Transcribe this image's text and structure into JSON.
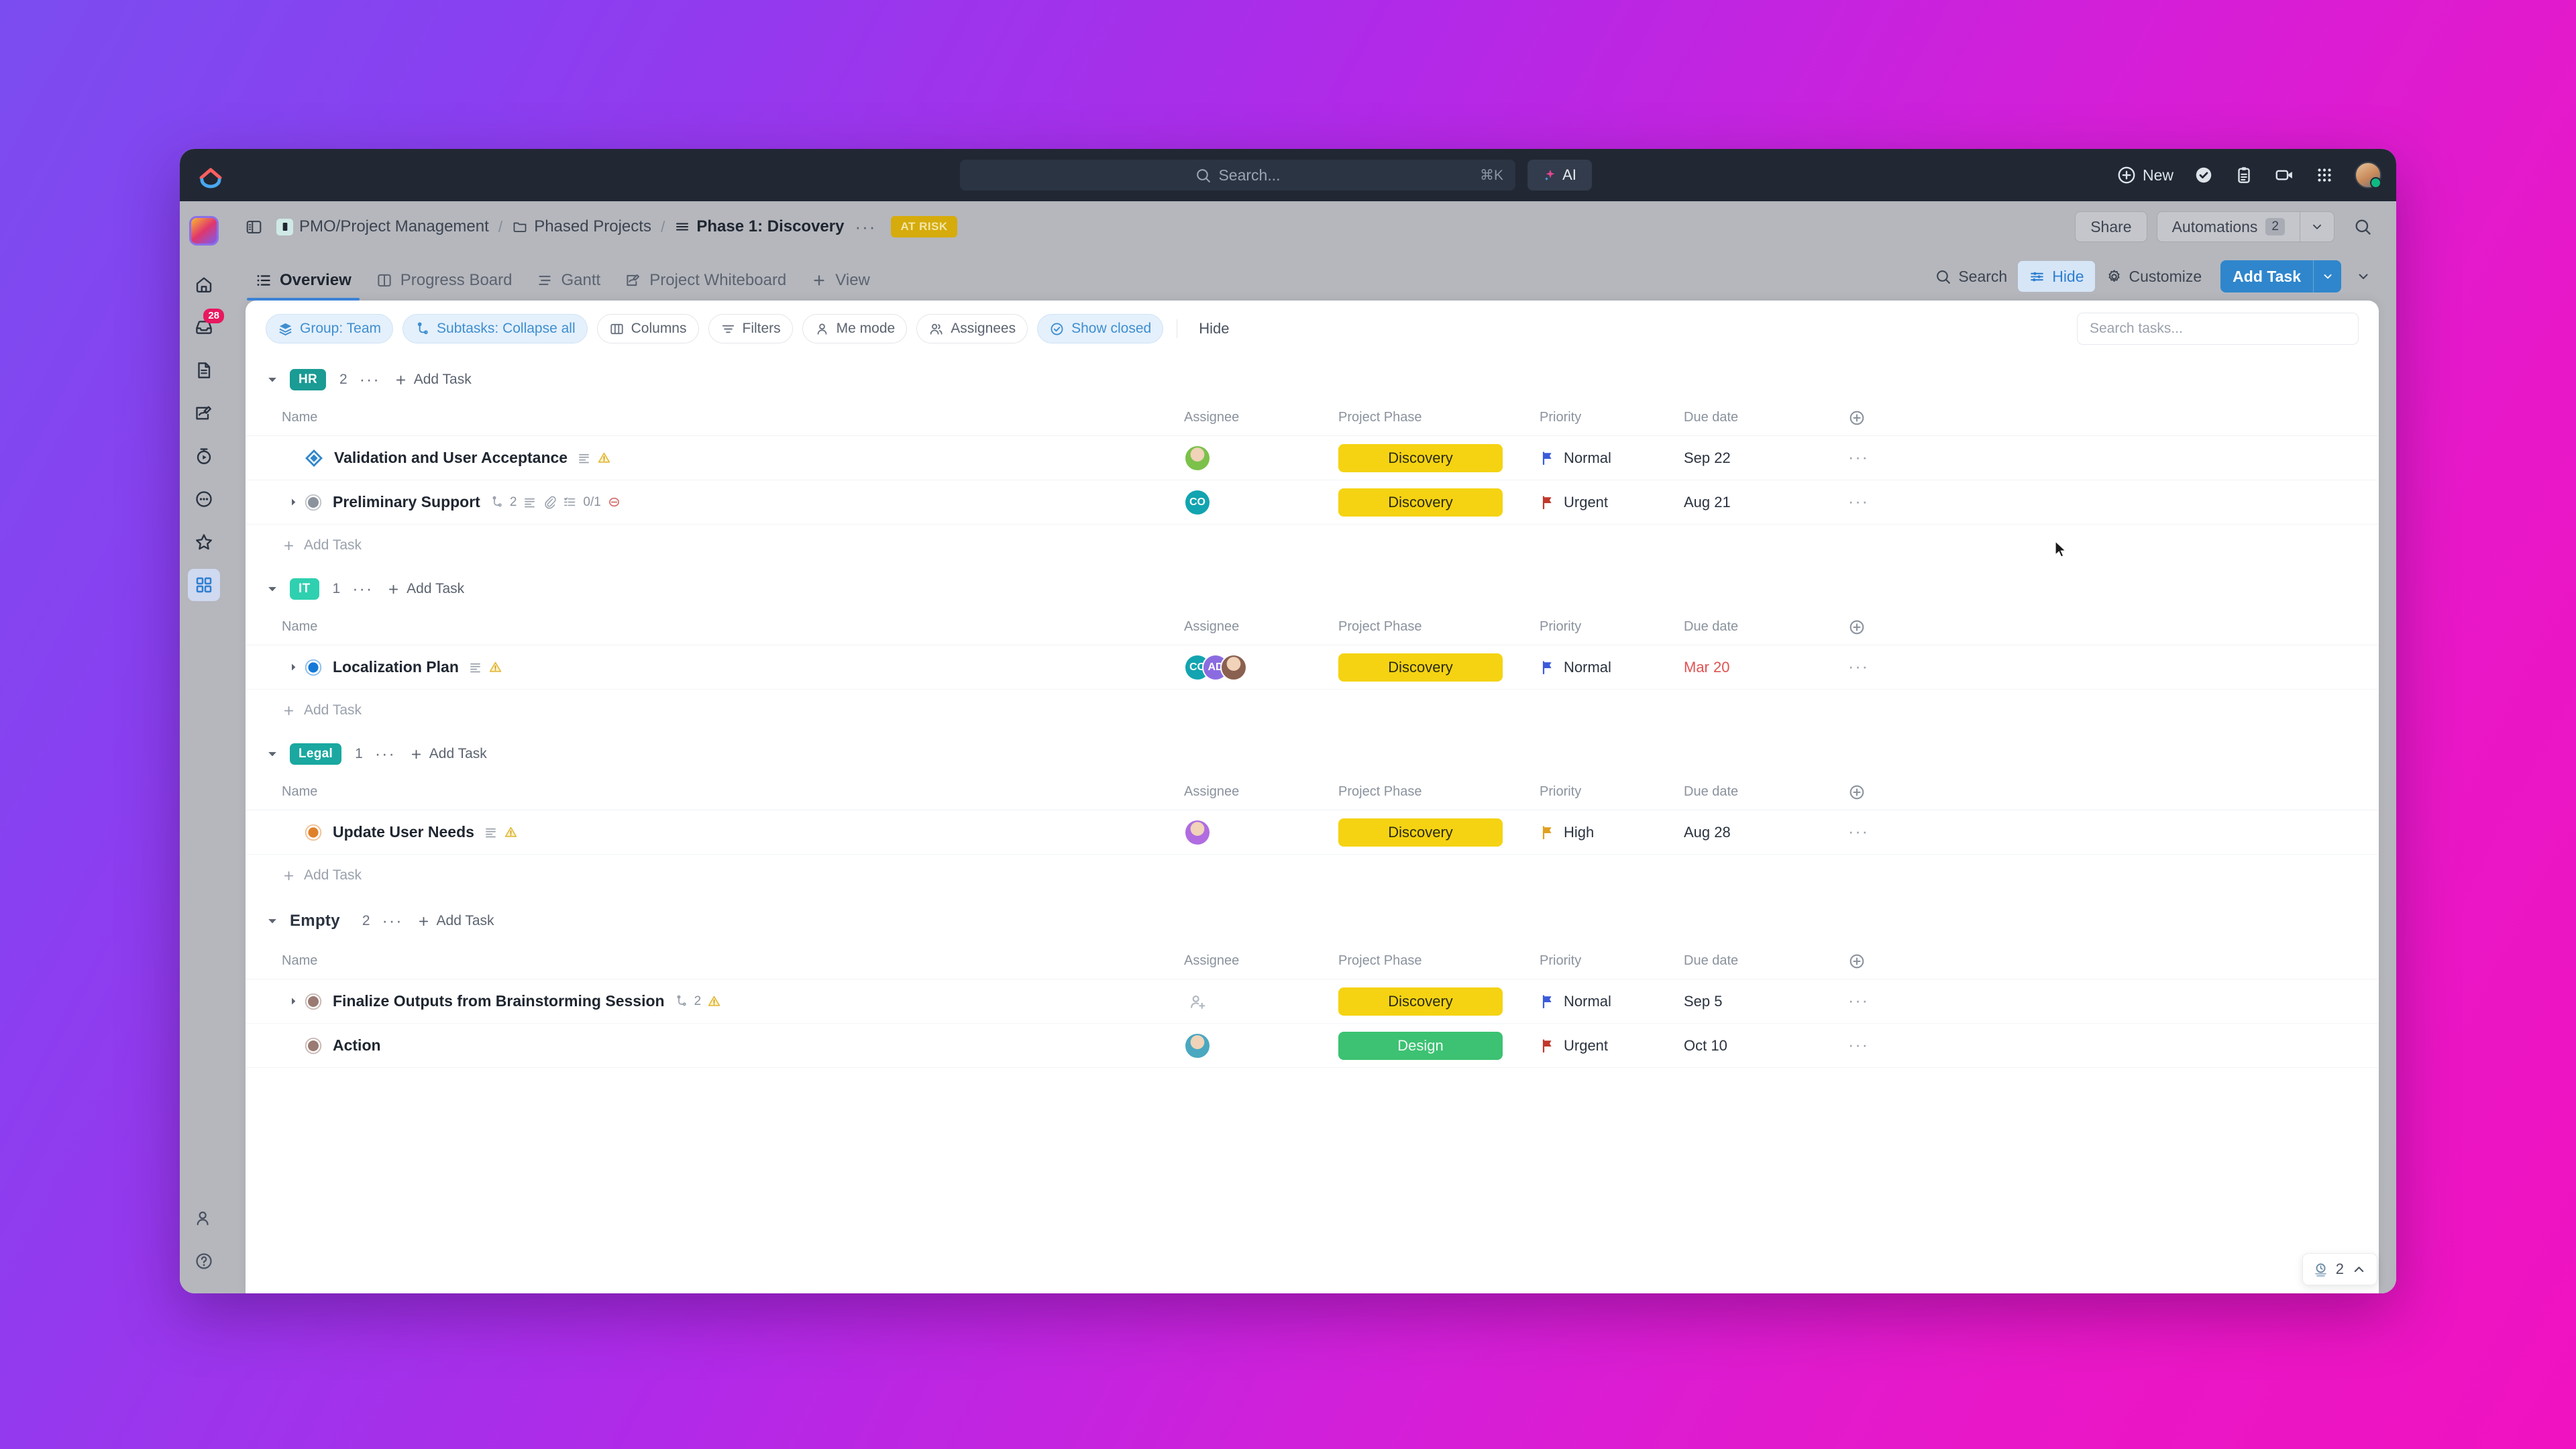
{
  "topbar": {
    "search_placeholder": "Search...",
    "search_shortcut": "⌘K",
    "ai_label": "AI",
    "new_label": "New",
    "icons": [
      "check-circle-icon",
      "clipboard-icon",
      "video-icon",
      "apps-grid-icon"
    ]
  },
  "sidebar": {
    "items": [
      {
        "name": "workspace-avatar",
        "label": ""
      },
      {
        "name": "home",
        "label": "Home"
      },
      {
        "name": "inbox",
        "label": "Inbox",
        "badge": "28"
      },
      {
        "name": "docs",
        "label": "Docs"
      },
      {
        "name": "whiteboards",
        "label": "Whiteboards"
      },
      {
        "name": "clips",
        "label": "Clips"
      },
      {
        "name": "chat",
        "label": "Chat"
      },
      {
        "name": "favorites",
        "label": "Favorites"
      },
      {
        "name": "dashboards",
        "label": "Dashboards",
        "active": true
      }
    ],
    "bottom": [
      {
        "name": "invite",
        "label": "Invite"
      },
      {
        "name": "help",
        "label": "Help"
      }
    ]
  },
  "breadcrumb": {
    "items": [
      {
        "label": "PMO/Project Management",
        "icon": "list-square-icon"
      },
      {
        "label": "Phased Projects",
        "icon": "folder-icon"
      },
      {
        "label": "Phase 1: Discovery",
        "icon": "list-icon",
        "current": true
      }
    ],
    "separator": "/",
    "overflow": "···",
    "status_badge": "AT RISK",
    "status_badge_color": "#d6ab0c"
  },
  "header_actions": {
    "share": "Share",
    "automations": "Automations",
    "automations_count": "2"
  },
  "tabs": [
    {
      "label": "Overview",
      "icon": "overview-icon",
      "active": true
    },
    {
      "label": "Progress Board",
      "icon": "board-icon",
      "active": false
    },
    {
      "label": "Gantt",
      "icon": "gantt-icon",
      "active": false
    },
    {
      "label": "Project Whiteboard",
      "icon": "whiteboard-icon",
      "active": false
    },
    {
      "label": "View",
      "icon": "plus-icon",
      "active": false
    }
  ],
  "view_actions": {
    "search": "Search",
    "hide": "Hide",
    "customize": "Customize",
    "add_task": "Add Task"
  },
  "filters": {
    "pills": [
      {
        "label": "Group: Team",
        "icon": "layers-icon",
        "active": true
      },
      {
        "label": "Subtasks: Collapse all",
        "icon": "subtask-icon",
        "active": true
      },
      {
        "label": "Columns",
        "icon": "columns-icon",
        "active": false
      },
      {
        "label": "Filters",
        "icon": "filter-icon",
        "active": false
      },
      {
        "label": "Me mode",
        "icon": "person-icon",
        "active": false
      },
      {
        "label": "Assignees",
        "icon": "people-icon",
        "active": false
      },
      {
        "label": "Show closed",
        "icon": "check-circle-icon",
        "active": true
      }
    ],
    "hide_label": "Hide",
    "search_placeholder": "Search tasks..."
  },
  "table": {
    "columns": [
      "Name",
      "Assignee",
      "Project Phase",
      "Priority",
      "Due date"
    ],
    "add_column_icon": "plus-circle-icon",
    "add_task_label": "Add Task",
    "group_add_task_label": "Add Task"
  },
  "groups": [
    {
      "name": "HR",
      "badge_color": "#1a9b94",
      "count": "2",
      "plain": false,
      "tasks": [
        {
          "name": "Validation and User Acceptance",
          "status_icon": "diamond",
          "status_color": "#2f86cc",
          "expandable": false,
          "meta": {
            "description": true,
            "warning": true
          },
          "assignees": [
            {
              "type": "photo",
              "tone": "#7cc14a"
            }
          ],
          "phase": "Discovery",
          "phase_color": "#f5d312",
          "priority": "Normal",
          "priority_color": "#3b5bdb",
          "due": "Sep 22",
          "due_overdue": false
        },
        {
          "name": "Preliminary Support",
          "status_icon": "filled-circle",
          "status_color": "#8a929d",
          "expandable": true,
          "meta": {
            "subtasks": "2",
            "description": true,
            "attachment": true,
            "checklist": "0/1",
            "blocked": true
          },
          "assignees": [
            {
              "type": "initials",
              "text": "CO",
              "tone": "#12a4b0"
            }
          ],
          "phase": "Discovery",
          "phase_color": "#f5d312",
          "priority": "Urgent",
          "priority_color": "#c0392b",
          "due": "Aug 21",
          "due_overdue": false
        }
      ]
    },
    {
      "name": "IT",
      "badge_color": "#2fd0b0",
      "count": "1",
      "plain": false,
      "tasks": [
        {
          "name": "Localization Plan",
          "status_icon": "ring-circle",
          "status_color": "#1479d6",
          "expandable": true,
          "meta": {
            "description": true,
            "warning": true
          },
          "assignees": [
            {
              "type": "initials",
              "text": "CO",
              "tone": "#12a4b0"
            },
            {
              "type": "initials",
              "text": "AD",
              "tone": "#8b6ce0"
            },
            {
              "type": "photo",
              "tone": "#8a6050"
            }
          ],
          "phase": "Discovery",
          "phase_color": "#f5d312",
          "priority": "Normal",
          "priority_color": "#3b5bdb",
          "due": "Mar 20",
          "due_overdue": true
        }
      ]
    },
    {
      "name": "Legal",
      "badge_color": "#1aa8a0",
      "count": "1",
      "plain": false,
      "tasks": [
        {
          "name": "Update User Needs",
          "status_icon": "ring-circle",
          "status_color": "#e0812a",
          "expandable": false,
          "meta": {
            "description": true,
            "warning": true
          },
          "assignees": [
            {
              "type": "photo",
              "tone": "#b06ce0"
            }
          ],
          "phase": "Discovery",
          "phase_color": "#f5d312",
          "priority": "High",
          "priority_color": "#e0a020",
          "due": "Aug 28",
          "due_overdue": false
        }
      ]
    },
    {
      "name": "Empty",
      "badge_color": "",
      "count": "2",
      "plain": true,
      "tasks": [
        {
          "name": "Finalize Outputs from Brainstorming Session",
          "status_icon": "filled-circle",
          "status_color": "#9a7a72",
          "expandable": true,
          "meta": {
            "subtasks": "2",
            "warning": true
          },
          "assignees": [
            {
              "type": "add",
              "text": ""
            }
          ],
          "phase": "Discovery",
          "phase_color": "#f5d312",
          "priority": "Normal",
          "priority_color": "#3b5bdb",
          "due": "Sep 5",
          "due_overdue": false
        },
        {
          "name": "Action",
          "status_icon": "filled-circle",
          "status_color": "#9a7a72",
          "expandable": false,
          "meta": {},
          "assignees": [
            {
              "type": "photo",
              "tone": "#4aa8c0"
            }
          ],
          "phase": "Design",
          "phase_color": "#3cc272",
          "priority": "Urgent",
          "priority_color": "#c0392b",
          "due": "Oct 10",
          "due_overdue": false
        }
      ]
    }
  ],
  "timer_widget": {
    "count": "2",
    "icon": "time-tracking-icon"
  }
}
